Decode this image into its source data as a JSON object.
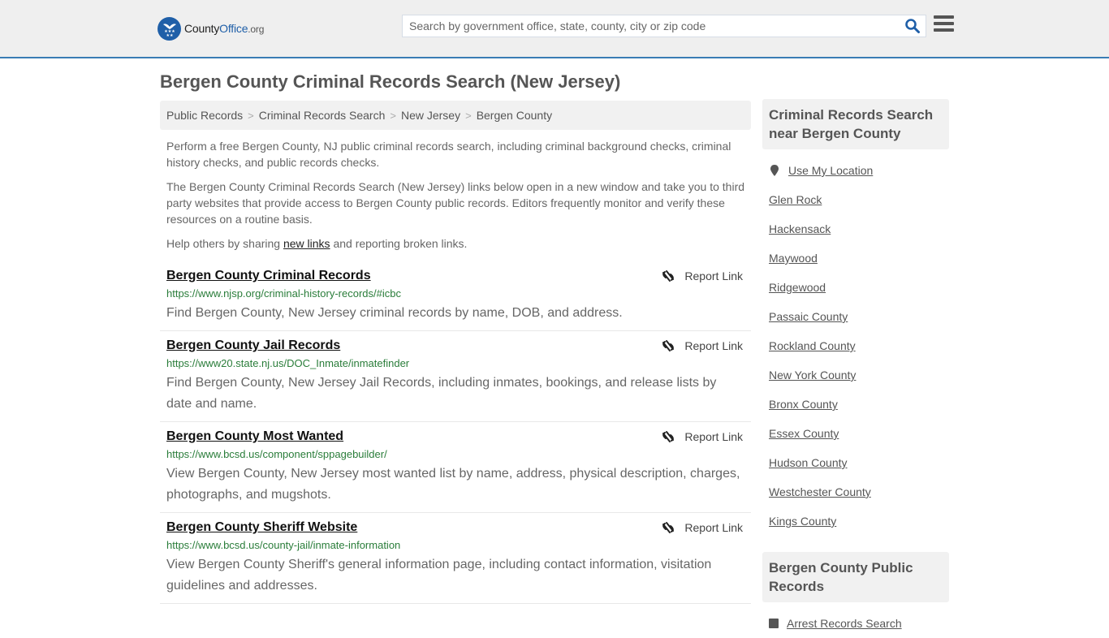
{
  "header": {
    "logo": {
      "name_part1": "County",
      "name_part2": "Office",
      "name_part3": ".org"
    },
    "search": {
      "placeholder": "Search by government office, state, county, city or zip code",
      "value": ""
    },
    "colors": {
      "brand": "#1f5fa8",
      "header_border": "#3a7db4",
      "url_green": "#2a7d3a"
    }
  },
  "page": {
    "title": "Bergen County Criminal Records Search (New Jersey)",
    "breadcrumb": [
      "Public Records",
      "Criminal Records Search",
      "New Jersey",
      "Bergen County"
    ],
    "breadcrumb_separator": ">",
    "intro": {
      "p1": "Perform a free Bergen County, NJ public criminal records search, including criminal background checks, criminal history checks, and public records checks.",
      "p2": "The Bergen County Criminal Records Search (New Jersey) links below open in a new window and take you to third party websites that provide access to Bergen County public records. Editors frequently monitor and verify these resources on a routine basis.",
      "p3_before": "Help others by sharing ",
      "p3_link": "new links",
      "p3_after": " and reporting broken links."
    }
  },
  "results": [
    {
      "title": "Bergen County Criminal Records",
      "url": "https://www.njsp.org/criminal-history-records/#icbc",
      "description": "Find Bergen County, New Jersey criminal records by name, DOB, and address.",
      "report_label": "Report Link"
    },
    {
      "title": "Bergen County Jail Records",
      "url": "https://www20.state.nj.us/DOC_Inmate/inmatefinder",
      "description": "Find Bergen County, New Jersey Jail Records, including inmates, bookings, and release lists by date and name.",
      "report_label": "Report Link"
    },
    {
      "title": "Bergen County Most Wanted",
      "url": "https://www.bcsd.us/component/sppagebuilder/",
      "description": "View Bergen County, New Jersey most wanted list by name, address, physical description, charges, photographs, and mugshots.",
      "report_label": "Report Link"
    },
    {
      "title": "Bergen County Sheriff Website",
      "url": "https://www.bcsd.us/county-jail/inmate-information",
      "description": "View Bergen County Sheriff's general information page, including contact information, visitation guidelines and addresses.",
      "report_label": "Report Link"
    }
  ],
  "sidebar": {
    "nearby": {
      "heading": "Criminal Records Search near Bergen County",
      "use_location": "Use My Location",
      "items": [
        "Glen Rock",
        "Hackensack",
        "Maywood",
        "Ridgewood",
        "Passaic County",
        "Rockland County",
        "New York County",
        "Bronx County",
        "Essex County",
        "Hudson County",
        "Westchester County",
        "Kings County"
      ]
    },
    "public_records": {
      "heading": "Bergen County Public Records",
      "items": [
        "Arrest Records Search"
      ]
    }
  }
}
